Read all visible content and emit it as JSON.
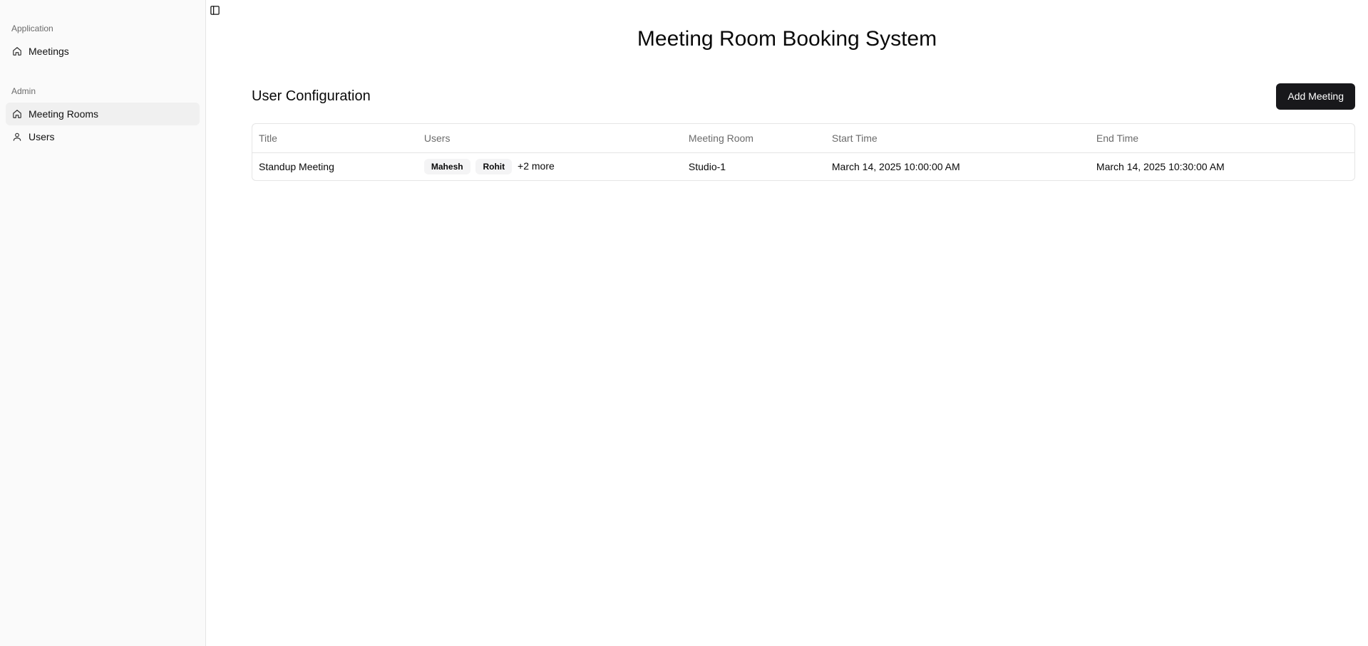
{
  "sidebar": {
    "groups": [
      {
        "label": "Application",
        "items": [
          {
            "label": "Meetings",
            "icon": "home-icon",
            "active": false
          }
        ]
      },
      {
        "label": "Admin",
        "items": [
          {
            "label": "Meeting Rooms",
            "icon": "home-icon",
            "active": true
          },
          {
            "label": "Users",
            "icon": "user-icon",
            "active": false
          }
        ]
      }
    ]
  },
  "header": {
    "toggle_icon": "sidebar-toggle-icon",
    "title": "Meeting Room Booking System"
  },
  "main": {
    "section_title": "User Configuration",
    "add_button_label": "Add Meeting",
    "table": {
      "columns": [
        "Title",
        "Users",
        "Meeting Room",
        "Start Time",
        "End Time"
      ],
      "rows": [
        {
          "title": "Standup Meeting",
          "users": [
            "Mahesh",
            "Rohit"
          ],
          "more": "+2 more",
          "room": "Studio-1",
          "start": "March 14, 2025 10:00:00 AM",
          "end": "March 14, 2025 10:30:00 AM"
        }
      ]
    }
  }
}
